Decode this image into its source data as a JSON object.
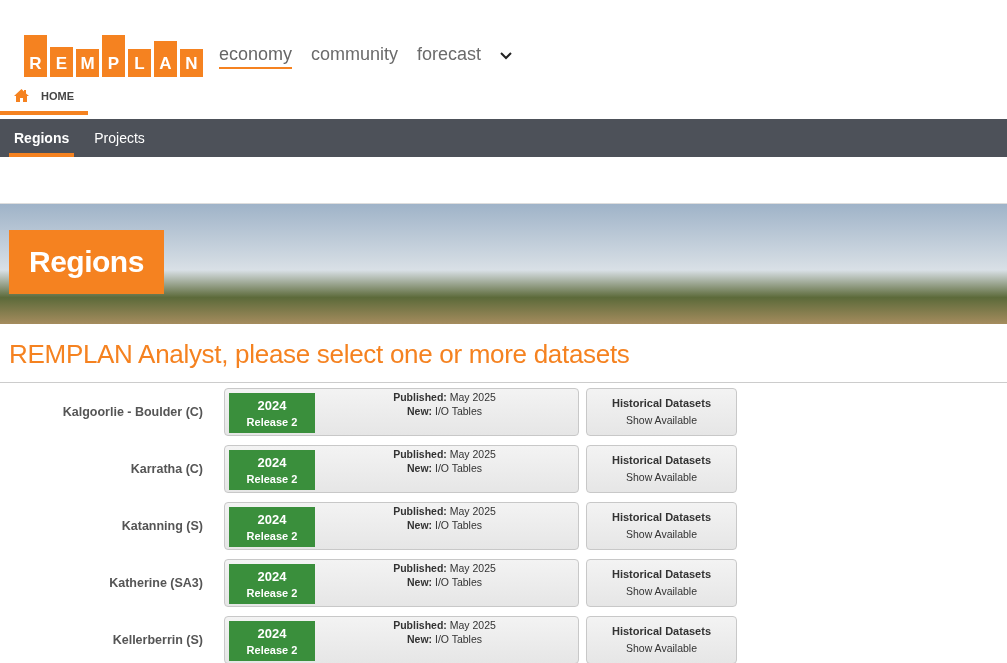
{
  "logo": {
    "letters": [
      "R",
      "E",
      "M",
      "P",
      "L",
      "A",
      "N"
    ]
  },
  "nav": [
    {
      "label": "economy",
      "selected": true
    },
    {
      "label": "community",
      "selected": false
    },
    {
      "label": "forecast",
      "selected": false
    }
  ],
  "breadcrumb": {
    "label": "HOME"
  },
  "subnav": [
    {
      "label": "Regions",
      "selected": true
    },
    {
      "label": "Projects",
      "selected": false
    }
  ],
  "banner": {
    "title": "Regions"
  },
  "heading": "REMPLAN Analyst, please select one or more datasets",
  "regions": [
    {
      "name": "Kalgoorlie - Boulder (C)",
      "year": "2024",
      "release": "Release 2",
      "published": "**Published:** May 2025",
      "new": "**New:** I/O Tables",
      "history_title": "Historical Datasets",
      "history_action": "Show Available"
    },
    {
      "name": "Karratha (C)",
      "year": "2024",
      "release": "Release 2",
      "published": "**Published:** May 2025",
      "new": "**New:** I/O Tables",
      "history_title": "Historical Datasets",
      "history_action": "Show Available"
    },
    {
      "name": "Katanning (S)",
      "year": "2024",
      "release": "Release 2",
      "published": "**Published:** May 2025",
      "new": "**New:** I/O Tables",
      "history_title": "Historical Datasets",
      "history_action": "Show Available"
    },
    {
      "name": "Katherine (SA3)",
      "year": "2024",
      "release": "Release 2",
      "published": "**Published:** May 2025",
      "new": "**New:** I/O Tables",
      "history_title": "Historical Datasets",
      "history_action": "Show Available"
    },
    {
      "name": "Kellerberrin (S)",
      "year": "2024",
      "release": "Release 2",
      "published": "**Published:** May 2025",
      "new": "**New:** I/O Tables",
      "history_title": "Historical Datasets",
      "history_action": "Show Available"
    }
  ]
}
